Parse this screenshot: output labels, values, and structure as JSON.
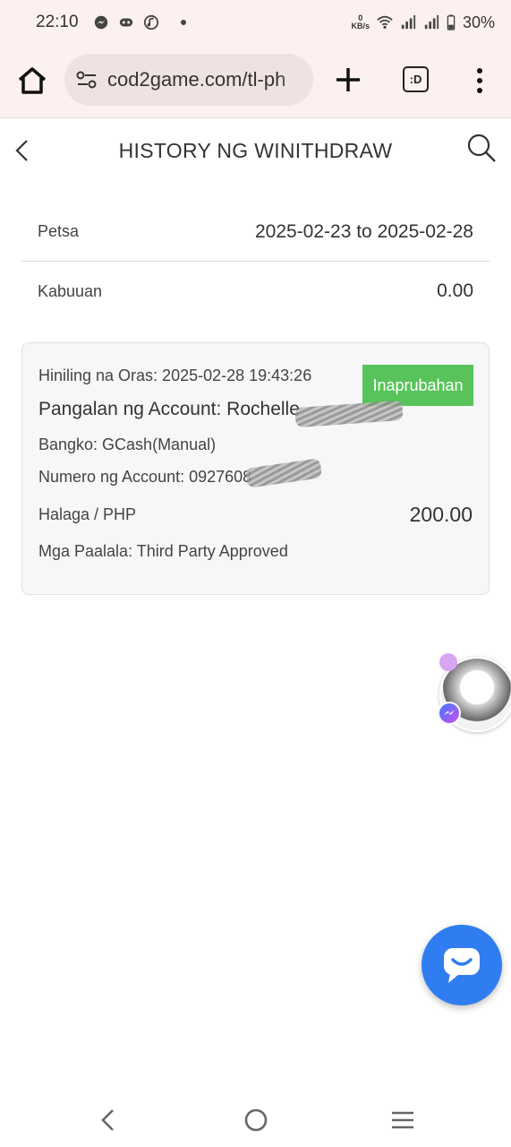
{
  "status_bar": {
    "time": "22:10",
    "net_speed_value": "0",
    "net_speed_unit": "KB/s",
    "battery": "30%"
  },
  "browser": {
    "url": "cod2game.com/tl-ph",
    "tab_label": ":D",
    "icons": [
      "home-icon",
      "site-settings-icon",
      "plus-icon",
      "tab-switcher-icon",
      "more-vert-icon"
    ]
  },
  "header": {
    "title": "HISTORY NG WINITHDRAW"
  },
  "summary": {
    "date_label": "Petsa",
    "date_value": "2025-02-23 to 2025-02-28",
    "total_label": "Kabuuan",
    "total_value": "0.00"
  },
  "record": {
    "time": "Hiniling na Oras: 2025-02-28 19:43:26",
    "status": "Inaprubahan",
    "account_name": "Pangalan ng Account: Rochelle",
    "bank": "Bangko: GCash(Manual)",
    "account_number": "Numero ng Account: 0927608",
    "amount_label": "Halaga / PHP",
    "amount_value": "200.00",
    "notes": "Mga Paalala: Third Party Approved"
  },
  "colors": {
    "status_green": "#58c35a",
    "chat_blue": "#2f7df0",
    "browser_bg": "#fdf1ef"
  }
}
